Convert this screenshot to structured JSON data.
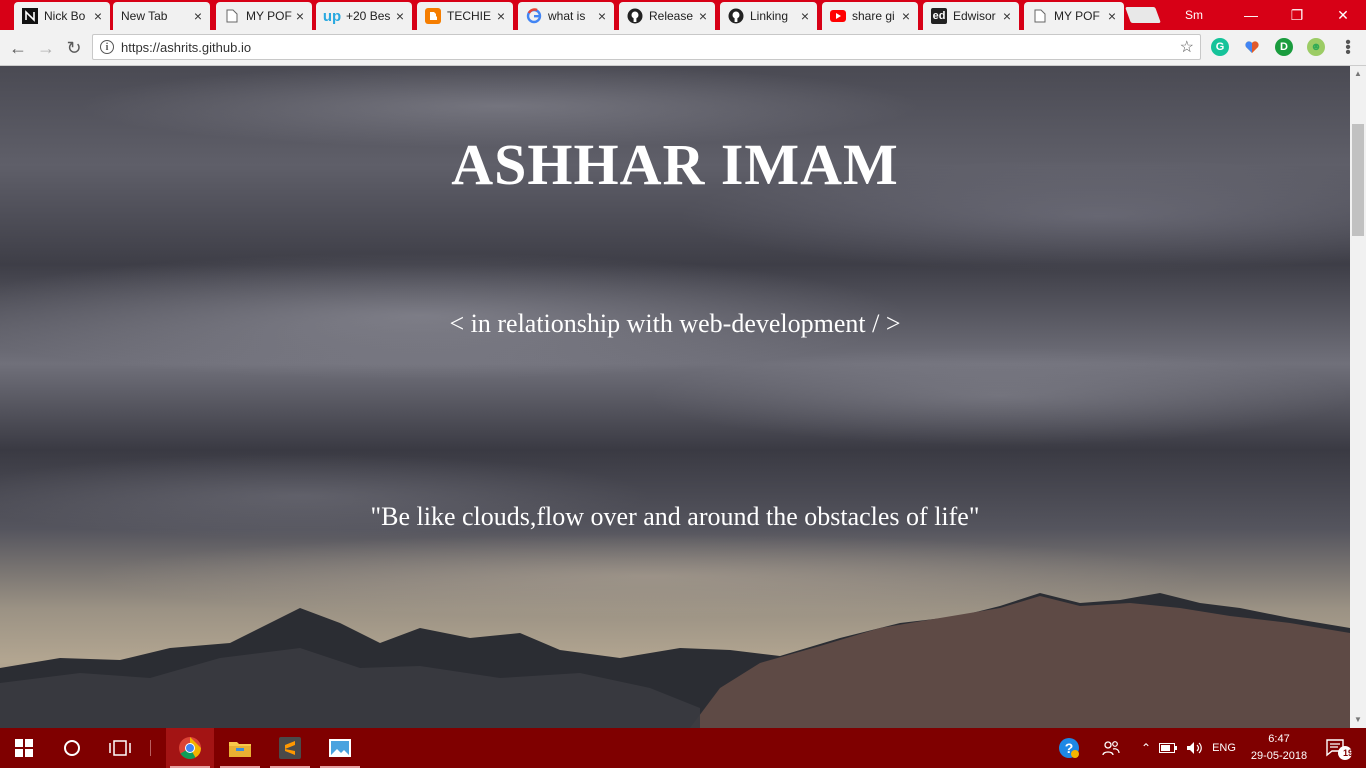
{
  "browser": {
    "tabs": [
      {
        "title": "Nick Bo",
        "icon": "nick-bostrom-icon"
      },
      {
        "title": "New Tab",
        "icon": "none"
      },
      {
        "title": "MY POF",
        "icon": "page-icon"
      },
      {
        "title": "+20 Bes",
        "icon": "up-logo-icon",
        "icon_text": "up"
      },
      {
        "title": "TECHIE",
        "icon": "blogger-icon"
      },
      {
        "title": "what is",
        "icon": "google-icon"
      },
      {
        "title": "Release",
        "icon": "github-icon"
      },
      {
        "title": "Linking",
        "icon": "github-icon"
      },
      {
        "title": "share gi",
        "icon": "youtube-icon"
      },
      {
        "title": "Edwisor",
        "icon": "edwisor-icon",
        "icon_text": "ed"
      },
      {
        "title": "MY POF",
        "icon": "page-icon",
        "active": true
      }
    ],
    "close_glyph": "×",
    "profile_name": "Sm",
    "window_controls": {
      "minimize": "—",
      "restore": "❐",
      "close": "✕"
    },
    "nav": {
      "back": "←",
      "forward": "→",
      "reload": "↻"
    },
    "address_bar": {
      "url": "https://ashrits.github.io",
      "info_glyph": "i",
      "star_glyph": "☆"
    },
    "extensions": [
      {
        "name": "grammarly-icon",
        "letter": "G",
        "color": "#15c39a"
      },
      {
        "name": "colorful-heart-icon",
        "letter": "♥",
        "color": "#ffffff"
      },
      {
        "name": "ext-d-icon",
        "letter": "D",
        "color": "#1a9c3e"
      },
      {
        "name": "android-icon",
        "letter": "☻",
        "color": "#9ccc65"
      }
    ],
    "menu_glyph": "⋮"
  },
  "page": {
    "title": "ASHHAR IMAM",
    "subtitle": "< in relationship with web-development / >",
    "quote": "\"Be like clouds,flow over and around the obstacles of life\""
  },
  "scrollbar": {
    "up": "▲",
    "down": "▼"
  },
  "taskbar": {
    "apps": [
      {
        "name": "chrome-icon",
        "active": true
      },
      {
        "name": "file-explorer-icon"
      },
      {
        "name": "sublime-text-icon"
      },
      {
        "name": "photos-icon"
      }
    ],
    "tray": {
      "language": "ENG",
      "time": "6:47",
      "date": "29-05-2018",
      "notifications_count": "19"
    }
  },
  "colors": {
    "tabstrip": "#d70016",
    "taskbar": "#7f0000",
    "hero_text": "#ffffff"
  }
}
